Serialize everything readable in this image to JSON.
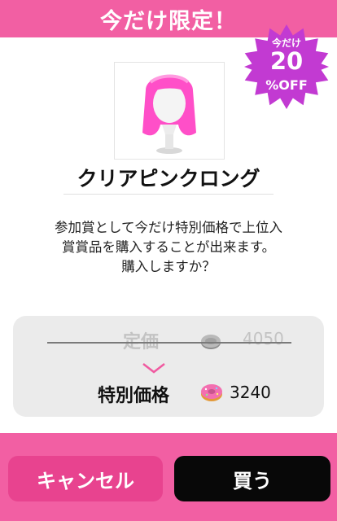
{
  "header": {
    "title": "今だけ限定！"
  },
  "badge": {
    "line1": "今だけ",
    "line2": "20",
    "line3": "%OFF"
  },
  "item": {
    "name": "クリアピンクロング",
    "image_icon": "pink-hair-mannequin-icon"
  },
  "description": {
    "line1": "参加賞として今だけ特別価格で上位入",
    "line2": "賞賞品を購入することが出来ます。",
    "line3": "購入しますか？"
  },
  "price": {
    "regular_label": "定価",
    "regular_value": "4050",
    "regular_icon": "coin-icon",
    "special_label": "特別価格",
    "special_value": "3240",
    "special_icon": "donut-icon"
  },
  "buttons": {
    "cancel": "キャンセル",
    "buy": "買う"
  },
  "colors": {
    "accent_pink": "#f25fa3",
    "cancel_pink": "#e8438f",
    "buy_black": "#080808",
    "badge_purple": "#c23ad2"
  }
}
